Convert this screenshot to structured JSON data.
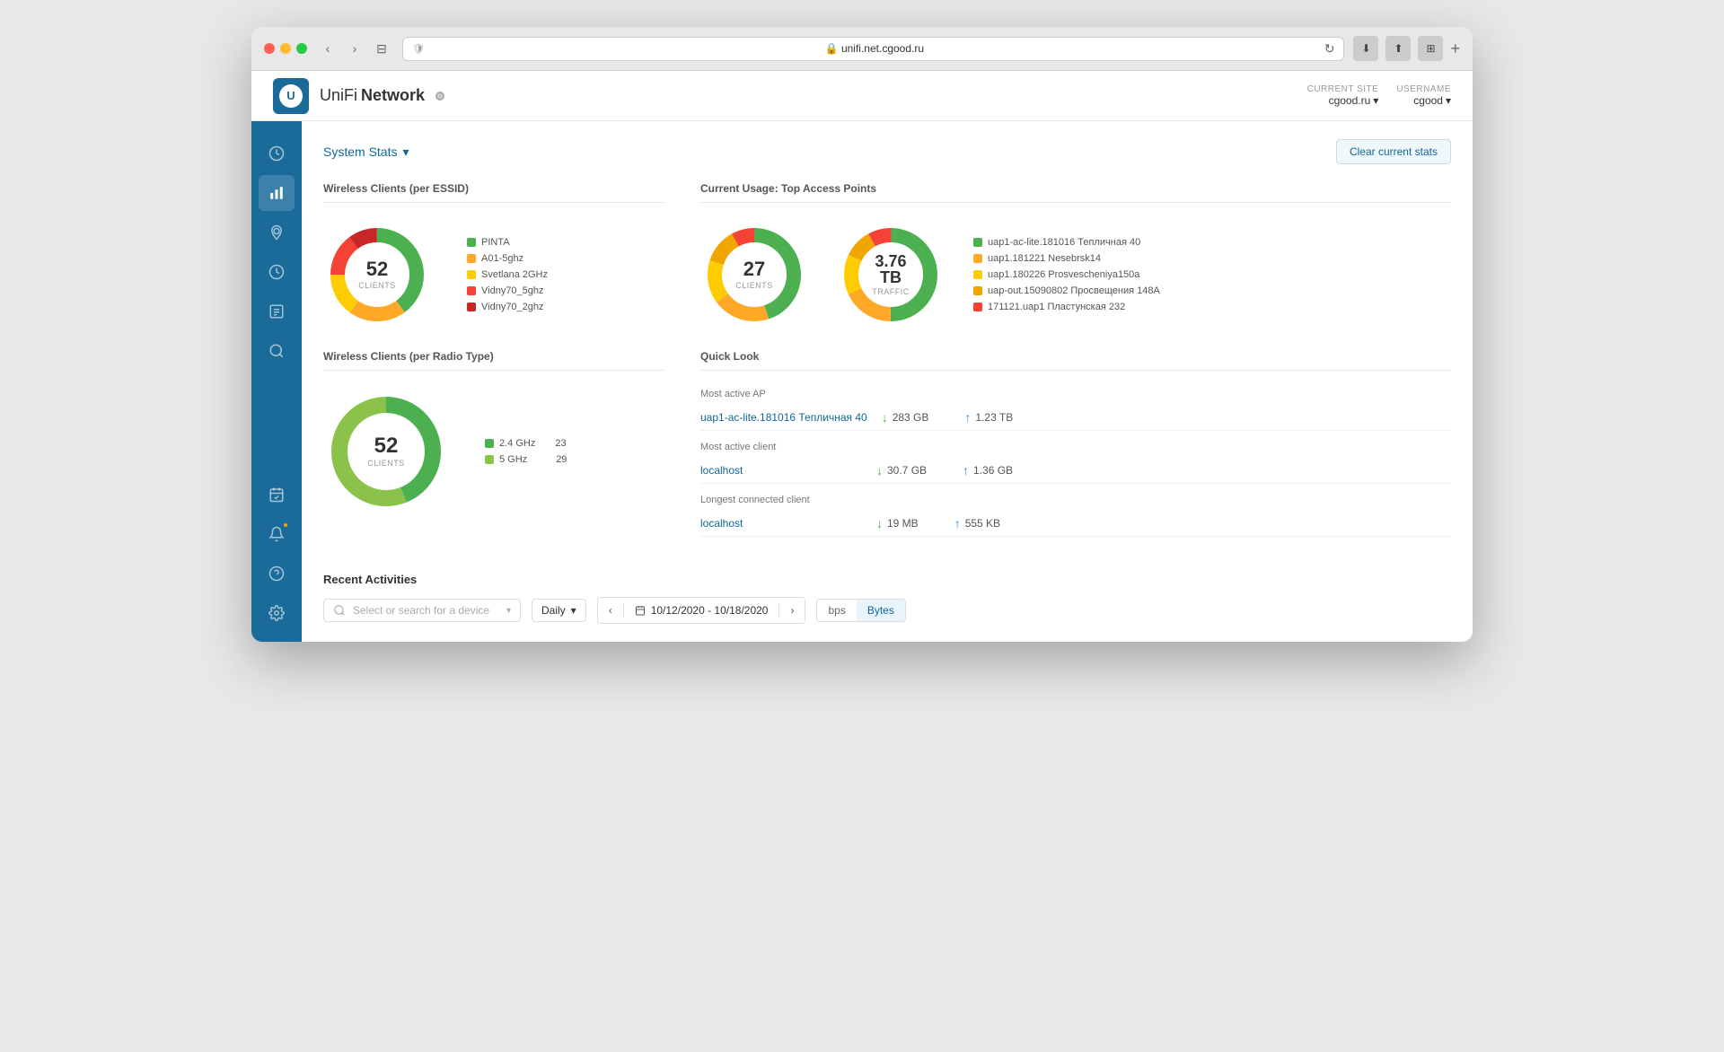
{
  "browser": {
    "url": "unifi.net.cgood.ru",
    "url_display": "🔒 unifi.net.cgood.ru"
  },
  "header": {
    "app_name": "UniFi",
    "app_subtitle": "Network",
    "current_site_label": "CURRENT SITE",
    "current_site_value": "cgood.ru",
    "username_label": "USERNAME",
    "username_value": "cgood",
    "status": "online"
  },
  "system_stats": {
    "title": "System Stats",
    "clear_button": "Clear current stats"
  },
  "wireless_per_essid": {
    "title": "Wireless Clients (per ESSID)",
    "total": "52",
    "label": "CLIENTS",
    "segments": [
      {
        "name": "PINTA",
        "color": "#4caf50",
        "percent": 40
      },
      {
        "name": "A01-5ghz",
        "color": "#ffa726",
        "percent": 20
      },
      {
        "name": "Svetlana 2GHz",
        "color": "#ffcc02",
        "percent": 15
      },
      {
        "name": "Vidny70_5ghz",
        "color": "#f44336",
        "percent": 15
      },
      {
        "name": "Vidny70_2ghz",
        "color": "#e53935",
        "percent": 10
      }
    ]
  },
  "top_access_points": {
    "title": "Current Usage: Top Access Points",
    "clients_total": "27",
    "clients_label": "CLIENTS",
    "traffic_total": "3.76 TB",
    "traffic_label": "TRAFFIC",
    "legend": [
      {
        "name": "uap1-ac-lite.181016 Тепличная 40",
        "color": "#4caf50"
      },
      {
        "name": "uap1.181221 Nesebrsk14",
        "color": "#ffa726"
      },
      {
        "name": "uap1.180226 Prosvescheniya150a",
        "color": "#ffcc02"
      },
      {
        "name": "uap-out.15090802 Просвещения 148А",
        "color": "#f0a500"
      },
      {
        "name": "171121.uap1 Пластунская 232",
        "color": "#f44336"
      }
    ],
    "clients_segments": [
      {
        "color": "#4caf50",
        "percent": 45
      },
      {
        "color": "#ffa726",
        "percent": 20
      },
      {
        "color": "#ffcc02",
        "percent": 15
      },
      {
        "color": "#f0a500",
        "percent": 12
      },
      {
        "color": "#f44336",
        "percent": 8
      }
    ],
    "traffic_segments": [
      {
        "color": "#4caf50",
        "percent": 50
      },
      {
        "color": "#ffa726",
        "percent": 18
      },
      {
        "color": "#ffcc02",
        "percent": 14
      },
      {
        "color": "#f0a500",
        "percent": 10
      },
      {
        "color": "#f44336",
        "percent": 8
      }
    ]
  },
  "wireless_per_radio": {
    "title": "Wireless Clients (per Radio Type)",
    "total": "52",
    "label": "CLIENTS",
    "segments": [
      {
        "name": "2.4 GHz",
        "color": "#4caf50",
        "percent": 44,
        "count": "23"
      },
      {
        "name": "5 GHz",
        "color": "#8bc34a",
        "percent": 56,
        "count": "29"
      }
    ]
  },
  "quick_look": {
    "title": "Quick Look",
    "most_active_ap": {
      "label": "Most active AP",
      "name": "uap1-ac-lite.181016 Тепличная 40",
      "download": "283 GB",
      "upload": "1.23 TB"
    },
    "most_active_client": {
      "label": "Most active client",
      "name": "localhost",
      "download": "30.7 GB",
      "upload": "1.36 GB"
    },
    "longest_connected": {
      "label": "Longest connected client",
      "name": "localhost",
      "download": "19 MB",
      "upload": "555 KB"
    }
  },
  "recent_activities": {
    "title": "Recent Activities",
    "search_placeholder": "Select or search for a device",
    "period": "Daily",
    "date_range": "10/12/2020 - 10/18/2020",
    "unit_bps": "bps",
    "unit_bytes": "Bytes",
    "active_unit": "Bytes"
  },
  "sidebar": {
    "items": [
      {
        "icon": "↻",
        "name": "dashboard"
      },
      {
        "icon": "📊",
        "name": "statistics",
        "active": true
      },
      {
        "icon": "📍",
        "name": "map"
      },
      {
        "icon": "⏱",
        "name": "events"
      },
      {
        "icon": "📋",
        "name": "reports"
      },
      {
        "icon": "🔍",
        "name": "insights"
      }
    ],
    "bottom": [
      {
        "icon": "📅",
        "name": "schedule"
      },
      {
        "icon": "🔔",
        "name": "notifications",
        "badge": true
      },
      {
        "icon": "❓",
        "name": "help"
      },
      {
        "icon": "⚙",
        "name": "settings"
      }
    ]
  }
}
